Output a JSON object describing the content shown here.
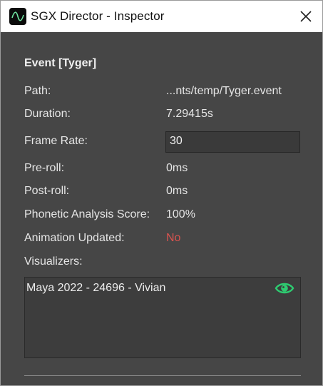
{
  "window": {
    "title": "SGX Director - Inspector"
  },
  "inspector": {
    "heading": "Event [Tyger]",
    "fields": [
      {
        "label": "Path:",
        "value": "...nts/temp/Tyger.event"
      },
      {
        "label": "Duration:",
        "value": "7.29415s"
      },
      {
        "label": "Frame Rate:",
        "value": "30"
      },
      {
        "label": "Pre-roll:",
        "value": "0ms"
      },
      {
        "label": "Post-roll:",
        "value": "0ms"
      },
      {
        "label": "Phonetic Analysis Score:",
        "value": "100%"
      },
      {
        "label": "Animation Updated:",
        "value": "No"
      }
    ],
    "visualizers_label": "Visualizers:",
    "visualizers": [
      {
        "name": "Maya 2022 - 24696 - Vivian",
        "icon": "eye-icon"
      }
    ]
  },
  "colors": {
    "background": "#464646",
    "warning_text": "#d9534f",
    "eye_icon": "#2ecc71"
  }
}
